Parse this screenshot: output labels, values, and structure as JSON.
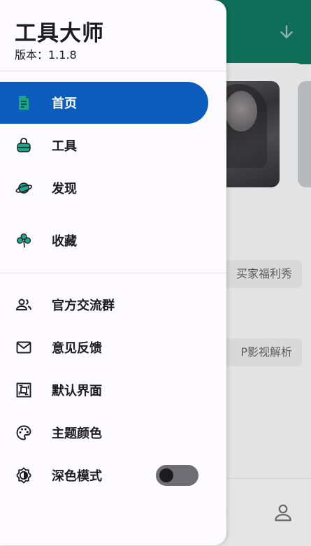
{
  "background": {
    "chip1": "买家福利秀",
    "chip2": "P影视解析"
  },
  "drawer": {
    "title": "工具大师",
    "version": "版本：1.1.8",
    "primary_items": [
      {
        "label": "首页",
        "icon": "document-icon",
        "active": true
      },
      {
        "label": "工具",
        "icon": "toolbox-icon",
        "active": false
      },
      {
        "label": "发现",
        "icon": "planet-icon",
        "active": false
      },
      {
        "label": "收藏",
        "icon": "clover-icon",
        "active": false
      }
    ],
    "secondary_items": [
      {
        "label": "官方交流群",
        "icon": "group-icon"
      },
      {
        "label": "意见反馈",
        "icon": "mail-icon"
      },
      {
        "label": "默认界面",
        "icon": "interface-icon"
      },
      {
        "label": "主题颜色",
        "icon": "palette-icon"
      },
      {
        "label": "深色模式",
        "icon": "brightness-icon",
        "toggle_on": false
      }
    ]
  },
  "colors": {
    "accent": "#0b5cbc",
    "header_green": "#0f6e58",
    "icon_teal": "#1aa68a"
  }
}
